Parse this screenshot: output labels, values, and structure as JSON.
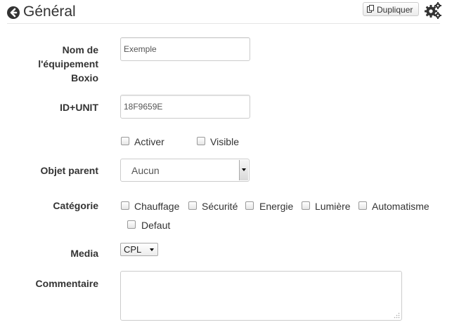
{
  "header": {
    "title": "Général",
    "duplicate_label": "Dupliquer",
    "icons": {
      "back": "arrow-left-circle-icon",
      "duplicate": "copy-icon",
      "config": "gears-icon"
    }
  },
  "form": {
    "name": {
      "label_lines": [
        "Nom de",
        "l'équipement",
        "Boxio"
      ],
      "value": "Exemple"
    },
    "id_unit": {
      "label": "ID+UNIT",
      "value": "18F9659E"
    },
    "activate": {
      "label": "Activer",
      "checked": false
    },
    "visible": {
      "label": "Visible",
      "checked": false
    },
    "parent": {
      "label": "Objet parent",
      "selected": "Aucun"
    },
    "category": {
      "label": "Catégorie",
      "options": [
        {
          "label": "Chauffage",
          "checked": false
        },
        {
          "label": "Sécurité",
          "checked": false
        },
        {
          "label": "Energie",
          "checked": false
        },
        {
          "label": "Lumière",
          "checked": false
        },
        {
          "label": "Automatisme",
          "checked": false
        },
        {
          "label": "Defaut",
          "checked": false
        }
      ]
    },
    "media": {
      "label": "Media",
      "selected": "CPL"
    },
    "comment": {
      "label": "Commentaire",
      "value": ""
    }
  },
  "colors": {
    "text": "#333333",
    "border": "#cccccc",
    "divider": "#e5e5e5"
  }
}
